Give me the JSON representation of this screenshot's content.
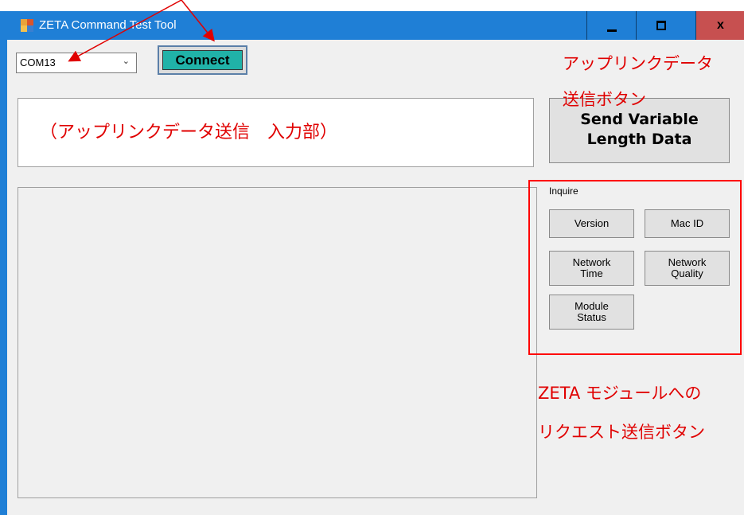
{
  "window": {
    "title": "ZETA Command Test Tool"
  },
  "titlebar_buttons": {
    "minimize_icon": "minimize-icon",
    "maximize_icon": "maximize-icon",
    "close": "x"
  },
  "connection": {
    "port_value": "COM13",
    "connect_label": "Connect"
  },
  "uplink": {
    "input_annotation": "（アップリンクデータ送信　入力部）",
    "send_label_line1": "Send Variable",
    "send_label_line2": "Length Data"
  },
  "inquire": {
    "group_label": "Inquire",
    "buttons": [
      {
        "line1": "Version",
        "line2": ""
      },
      {
        "line1": "Mac ID",
        "line2": ""
      },
      {
        "line1": "Network",
        "line2": "Time"
      },
      {
        "line1": "Network",
        "line2": "Quality"
      },
      {
        "line1": "Module",
        "line2": "Status"
      }
    ]
  },
  "annotations": {
    "uplink_send_line1": "アップリンクデータ",
    "uplink_send_line2": "送信ボタン",
    "zeta_request_line1": "ZETA モジュールへの",
    "zeta_request_line2": "リクエスト送信ボタン"
  },
  "colors": {
    "titlebar": "#1f7fd6",
    "close": "#c75050",
    "connect": "#20b2a8",
    "annotation": "#e00000"
  }
}
